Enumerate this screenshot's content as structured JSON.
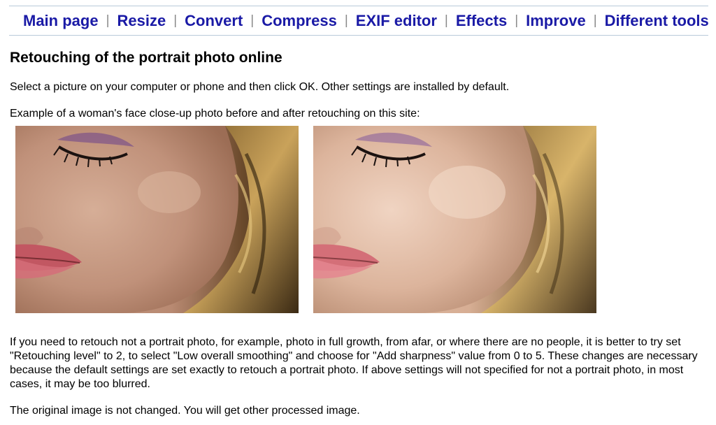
{
  "nav": {
    "items": [
      {
        "label": "Main page"
      },
      {
        "label": "Resize"
      },
      {
        "label": "Convert"
      },
      {
        "label": "Compress"
      },
      {
        "label": "EXIF editor"
      },
      {
        "label": "Effects"
      },
      {
        "label": "Improve"
      },
      {
        "label": "Different tools"
      }
    ],
    "separator": "|",
    "link_color": "#1a1aa6"
  },
  "page": {
    "title": "Retouching of the portrait photo online",
    "intro": "Select a picture on your computer or phone and then click OK. Other settings are installed by default.",
    "example_caption": "Example of a woman's face close-up photo before and after retouching on this site:",
    "advice": "If you need to retouch not a portrait photo, for example, photo in full growth, from afar, or where there are no people, it is better to try set \"Retouching level\" to 2, to select \"Low overall smoothing\" and choose for \"Add sharpness\" value from 0 to 5. These changes are necessary because the default settings are set exactly to retouch a portrait photo. If above settings will not specified for not a portrait photo, in most cases, it may be too blurred.",
    "note": "The original image is not changed. You will get other processed image."
  },
  "images": {
    "before": {
      "icon": "portrait-before-photo"
    },
    "after": {
      "icon": "portrait-after-photo"
    }
  }
}
